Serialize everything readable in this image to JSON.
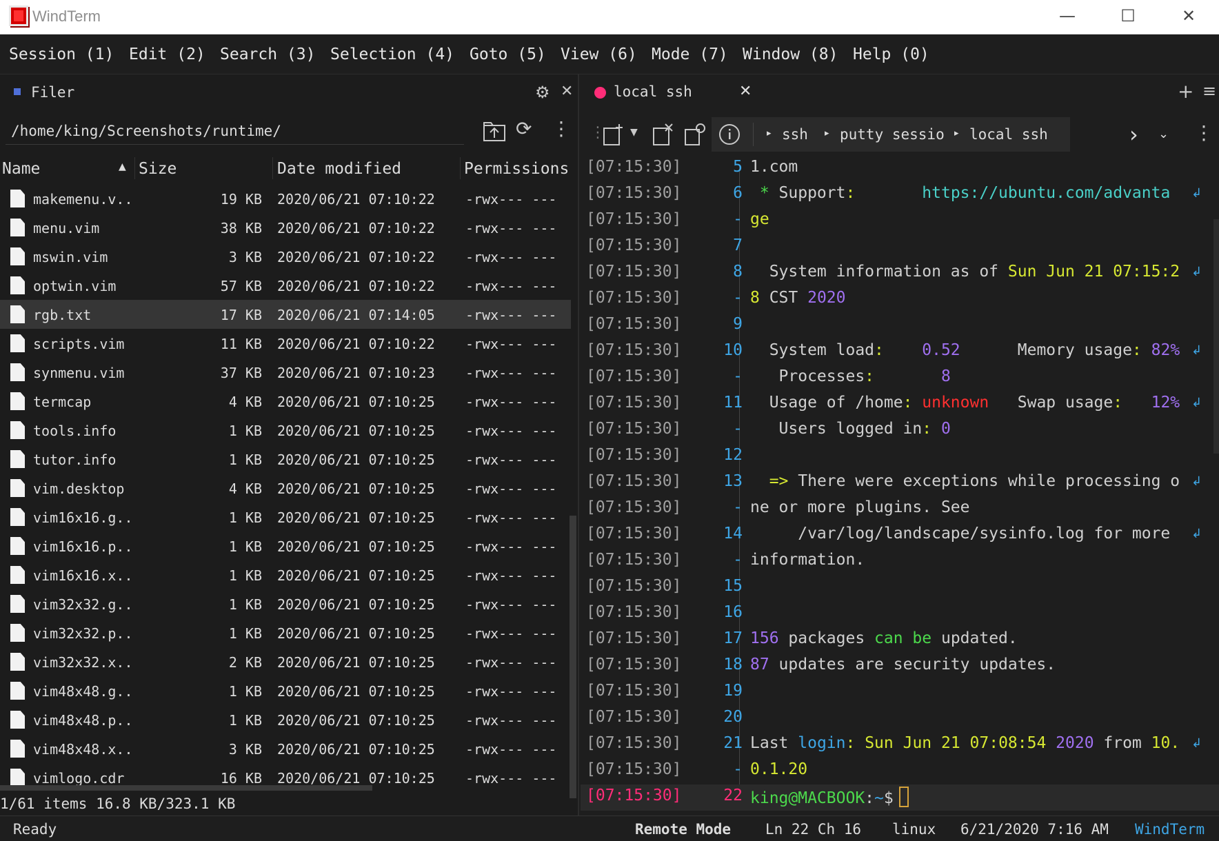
{
  "window": {
    "title": "WindTerm",
    "minimize": "—",
    "maximize": "☐",
    "close": "✕"
  },
  "menu": [
    "Session (1)",
    "Edit (2)",
    "Search (3)",
    "Selection (4)",
    "Goto (5)",
    "View (6)",
    "Mode (7)",
    "Window (8)",
    "Help (0)"
  ],
  "filer": {
    "tab_label": "Filer",
    "path": "/home/king/Screenshots/runtime/",
    "columns": [
      "Name",
      "Size",
      "Date modified",
      "Permissions"
    ],
    "files": [
      {
        "name": "makemenu.v..",
        "size": "19 KB",
        "date": "2020/06/21 07:10:22",
        "perm": "-rwx--- ---"
      },
      {
        "name": "menu.vim",
        "size": "38 KB",
        "date": "2020/06/21 07:10:22",
        "perm": "-rwx--- ---"
      },
      {
        "name": "mswin.vim",
        "size": "3 KB",
        "date": "2020/06/21 07:10:22",
        "perm": "-rwx--- ---"
      },
      {
        "name": "optwin.vim",
        "size": "57 KB",
        "date": "2020/06/21 07:10:22",
        "perm": "-rwx--- ---"
      },
      {
        "name": "rgb.txt",
        "size": "17 KB",
        "date": "2020/06/21 07:14:05",
        "perm": "-rwx--- ---"
      },
      {
        "name": "scripts.vim",
        "size": "11 KB",
        "date": "2020/06/21 07:10:22",
        "perm": "-rwx--- ---"
      },
      {
        "name": "synmenu.vim",
        "size": "37 KB",
        "date": "2020/06/21 07:10:23",
        "perm": "-rwx--- ---"
      },
      {
        "name": "termcap",
        "size": "4 KB",
        "date": "2020/06/21 07:10:25",
        "perm": "-rwx--- ---"
      },
      {
        "name": "tools.info",
        "size": "1 KB",
        "date": "2020/06/21 07:10:25",
        "perm": "-rwx--- ---"
      },
      {
        "name": "tutor.info",
        "size": "1 KB",
        "date": "2020/06/21 07:10:25",
        "perm": "-rwx--- ---"
      },
      {
        "name": "vim.desktop",
        "size": "4 KB",
        "date": "2020/06/21 07:10:25",
        "perm": "-rwx--- ---"
      },
      {
        "name": "vim16x16.g..",
        "size": "1 KB",
        "date": "2020/06/21 07:10:25",
        "perm": "-rwx--- ---"
      },
      {
        "name": "vim16x16.p..",
        "size": "1 KB",
        "date": "2020/06/21 07:10:25",
        "perm": "-rwx--- ---"
      },
      {
        "name": "vim16x16.x..",
        "size": "1 KB",
        "date": "2020/06/21 07:10:25",
        "perm": "-rwx--- ---"
      },
      {
        "name": "vim32x32.g..",
        "size": "1 KB",
        "date": "2020/06/21 07:10:25",
        "perm": "-rwx--- ---"
      },
      {
        "name": "vim32x32.p..",
        "size": "1 KB",
        "date": "2020/06/21 07:10:25",
        "perm": "-rwx--- ---"
      },
      {
        "name": "vim32x32.x..",
        "size": "2 KB",
        "date": "2020/06/21 07:10:25",
        "perm": "-rwx--- ---"
      },
      {
        "name": "vim48x48.g..",
        "size": "1 KB",
        "date": "2020/06/21 07:10:25",
        "perm": "-rwx--- ---"
      },
      {
        "name": "vim48x48.p..",
        "size": "1 KB",
        "date": "2020/06/21 07:10:25",
        "perm": "-rwx--- ---"
      },
      {
        "name": "vim48x48.x..",
        "size": "3 KB",
        "date": "2020/06/21 07:10:25",
        "perm": "-rwx--- ---"
      },
      {
        "name": "vimlogo.cdr",
        "size": "16 KB",
        "date": "2020/06/21 07:10:25",
        "perm": "-rwx--- ---"
      }
    ],
    "selected_index": 4,
    "status": "1/61 items 16.8 KB/323.1 KB"
  },
  "terminal": {
    "tab_label": "local ssh",
    "breadcrumb": [
      "ssh",
      "putty sessio",
      "local ssh"
    ],
    "lines": [
      {
        "ts": "[07:15:30]",
        "ln": "5",
        "segs": [
          [
            "1.com",
            "k"
          ]
        ]
      },
      {
        "ts": "[07:15:30]",
        "ln": "6",
        "segs": [
          [
            " * ",
            "gr"
          ],
          [
            "Support",
            "k"
          ],
          [
            ":",
            "g"
          ],
          [
            "       https://ubuntu.com/advanta",
            "c"
          ]
        ],
        "wrap": true
      },
      {
        "ts": "[07:15:30]",
        "ln": "-",
        "segs": [
          [
            "ge",
            "g"
          ]
        ]
      },
      {
        "ts": "[07:15:30]",
        "ln": "7",
        "segs": []
      },
      {
        "ts": "[07:15:30]",
        "ln": "8",
        "segs": [
          [
            "  System information as of ",
            "k"
          ],
          [
            "Sun Jun 21 07:15:2",
            "g"
          ]
        ],
        "wrap": true
      },
      {
        "ts": "[07:15:30]",
        "ln": "-",
        "segs": [
          [
            "8",
            "g"
          ],
          [
            " CST ",
            "k"
          ],
          [
            "2020",
            "p"
          ]
        ]
      },
      {
        "ts": "[07:15:30]",
        "ln": "9",
        "segs": []
      },
      {
        "ts": "[07:15:30]",
        "ln": "10",
        "segs": [
          [
            "  System load",
            "k"
          ],
          [
            ":",
            "g"
          ],
          [
            "    0.52      ",
            "p"
          ],
          [
            "Memory usage",
            "k"
          ],
          [
            ": ",
            "g"
          ],
          [
            "82%",
            "p"
          ]
        ],
        "wrap": true
      },
      {
        "ts": "[07:15:30]",
        "ln": "-",
        "segs": [
          [
            "   Processes",
            "k"
          ],
          [
            ":",
            "g"
          ],
          [
            "       8",
            "p"
          ]
        ]
      },
      {
        "ts": "[07:15:30]",
        "ln": "11",
        "segs": [
          [
            "  Usage of /home",
            "k"
          ],
          [
            ": ",
            "g"
          ],
          [
            "unknown",
            "r"
          ],
          [
            "   Swap usage",
            "k"
          ],
          [
            ":   ",
            "g"
          ],
          [
            "12%",
            "p"
          ]
        ],
        "wrap": true
      },
      {
        "ts": "[07:15:30]",
        "ln": "-",
        "segs": [
          [
            "   Users logged in",
            "k"
          ],
          [
            ": ",
            "g"
          ],
          [
            "0",
            "p"
          ]
        ]
      },
      {
        "ts": "[07:15:30]",
        "ln": "12",
        "segs": []
      },
      {
        "ts": "[07:15:30]",
        "ln": "13",
        "segs": [
          [
            "  => ",
            "g"
          ],
          [
            "There were exceptions while processing o",
            "k"
          ]
        ],
        "wrap": true
      },
      {
        "ts": "[07:15:30]",
        "ln": "-",
        "segs": [
          [
            "ne or more plugins. See",
            "k"
          ]
        ]
      },
      {
        "ts": "[07:15:30]",
        "ln": "14",
        "segs": [
          [
            "     /var/log/landscape/sysinfo.log for more ",
            "k"
          ]
        ],
        "wrap": true
      },
      {
        "ts": "[07:15:30]",
        "ln": "-",
        "segs": [
          [
            "information.",
            "k"
          ]
        ]
      },
      {
        "ts": "[07:15:30]",
        "ln": "15",
        "segs": []
      },
      {
        "ts": "[07:15:30]",
        "ln": "16",
        "segs": []
      },
      {
        "ts": "[07:15:30]",
        "ln": "17",
        "segs": [
          [
            "156",
            "p"
          ],
          [
            " packages ",
            "k"
          ],
          [
            "can be",
            "gr"
          ],
          [
            " updated.",
            "k"
          ]
        ]
      },
      {
        "ts": "[07:15:30]",
        "ln": "18",
        "segs": [
          [
            "87",
            "p"
          ],
          [
            " updates are security updates.",
            "k"
          ]
        ]
      },
      {
        "ts": "[07:15:30]",
        "ln": "19",
        "segs": []
      },
      {
        "ts": "[07:15:30]",
        "ln": "20",
        "segs": []
      },
      {
        "ts": "[07:15:30]",
        "ln": "21",
        "segs": [
          [
            "Last ",
            "k"
          ],
          [
            "login",
            "b"
          ],
          [
            ": ",
            "g"
          ],
          [
            "Sun Jun 21 07:08:54 ",
            "g"
          ],
          [
            "2020",
            "p"
          ],
          [
            " from ",
            "k"
          ],
          [
            "10.",
            "g"
          ]
        ],
        "wrap": true
      },
      {
        "ts": "[07:15:30]",
        "ln": "-",
        "segs": [
          [
            "0.1.20",
            "g"
          ]
        ]
      },
      {
        "ts": "[07:15:30]",
        "ln": "22",
        "segs": [
          [
            "king@MACBOOK",
            "gr"
          ],
          [
            ":",
            "k"
          ],
          [
            "~",
            "b"
          ],
          [
            "$",
            "k"
          ]
        ],
        "current": true
      }
    ]
  },
  "status": {
    "ready": "Ready",
    "mode": "Remote Mode",
    "position": "Ln 22 Ch 16",
    "os": "linux",
    "datetime": "6/21/2020 7:16 AM",
    "app": "WindTerm"
  },
  "colors": {
    "prompt_ts": "#ff2d78",
    "accent": "#3ea6e6",
    "tab_dot": "#ff2d78"
  }
}
